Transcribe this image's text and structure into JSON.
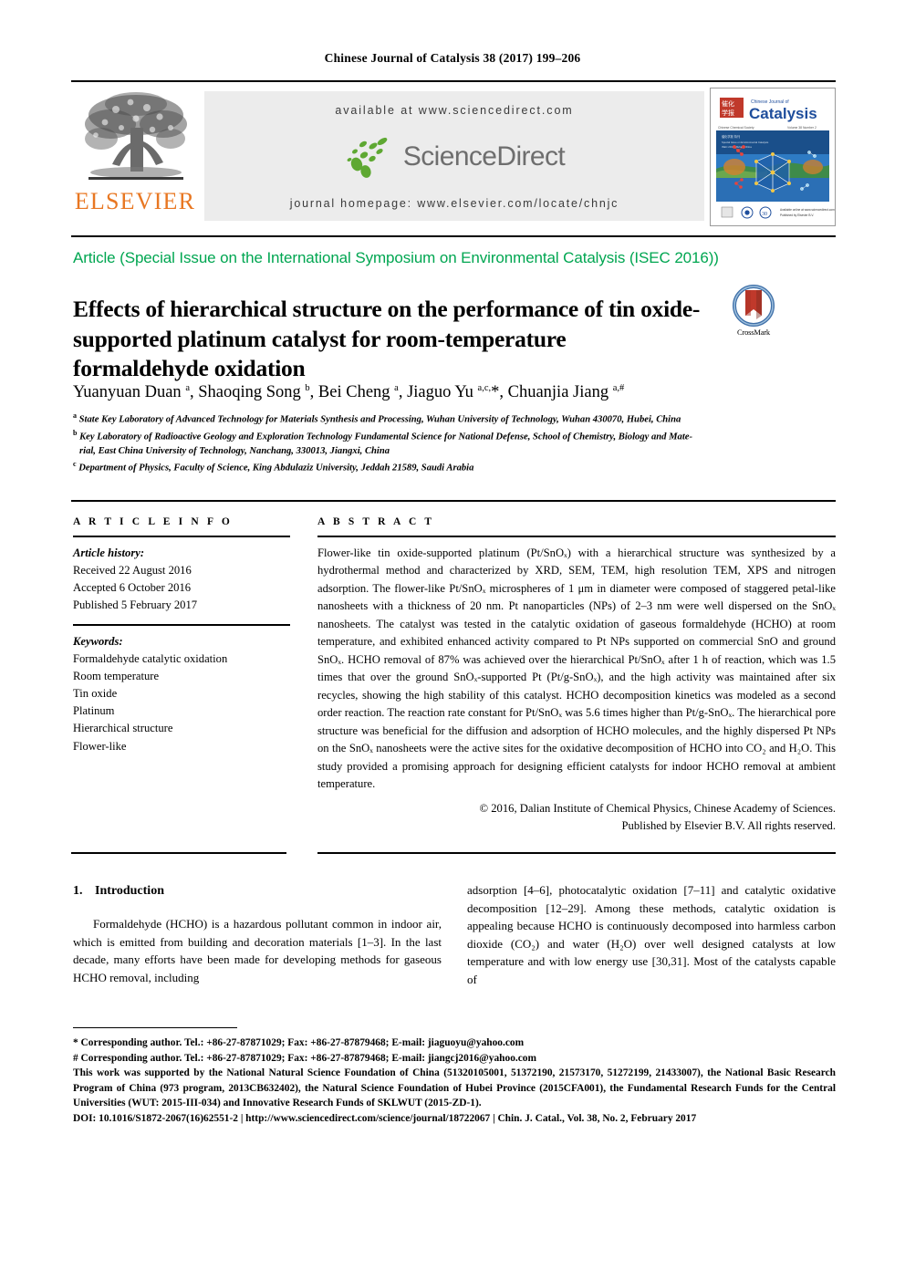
{
  "running_head": "Chinese Journal of Catalysis 38 (2017) 199–206",
  "masthead": {
    "publisher": "ELSEVIER",
    "available_at": "available at www.sciencedirect.com",
    "sciencedirect": "ScienceDirect",
    "journal_homepage": "journal homepage: www.elsevier.com/locate/chnjc",
    "cover": {
      "series_small": "Chinese Journal of",
      "title": "Catalysis",
      "chinese_title": "催化学报",
      "volume_line": "Volume 38  Number 2  February 2017"
    }
  },
  "article_type": "Article (Special Issue on the International Symposium on Environmental Catalysis (ISEC 2016))",
  "crossmark": {
    "label": "CrossMark"
  },
  "title": "Effects of hierarchical structure on the performance of tin oxide-supported platinum catalyst for room-temperature formaldehyde oxidation",
  "authors": "Yuanyuan Duan <sup>a</sup>, Shaoqing Song <sup>b</sup>, Bei Cheng <sup>a</sup>, Jiaguo Yu <sup>a,c,</sup>*, Chuanjia Jiang <sup>a,#</sup>",
  "affiliations": [
    {
      "marker": "a",
      "text": "State Key Laboratory of Advanced Technology for Materials Synthesis and Processing, Wuhan University of Technology, Wuhan 430070, Hubei, China"
    },
    {
      "marker": "b",
      "text": "Key Laboratory of Radioactive Geology and Exploration Technology Fundamental Science for National Defense, School of Chemistry, Biology and Mate-",
      "cont": "rial, East China University of Technology, Nanchang, 330013, Jiangxi, China"
    },
    {
      "marker": "c",
      "text": "Department of Physics, Faculty of Science, King Abdulaziz University, Jeddah 21589, Saudi Arabia"
    }
  ],
  "article_info": {
    "heading": "A R T I C L E    I N F O",
    "history_label": "Article history:",
    "history": [
      "Received 22 August 2016",
      "Accepted 6 October 2016",
      "Published 5 February 2017"
    ],
    "keywords_label": "Keywords:",
    "keywords": [
      "Formaldehyde catalytic oxidation",
      "Room temperature",
      "Tin oxide",
      "Platinum",
      "Hierarchical structure",
      "Flower-like"
    ]
  },
  "abstract": {
    "heading": "A B S T R A C T",
    "text": "Flower-like tin oxide-supported platinum (Pt/SnOₓ) with a hierarchical structure was synthesized by a hydrothermal method and characterized by XRD, SEM, TEM, high resolution TEM, XPS and nitrogen adsorption. The flower-like Pt/SnOₓ microspheres of 1 μm in diameter were composed of staggered petal-like nanosheets with a thickness of 20 nm. Pt nanoparticles (NPs) of 2–3 nm were well dispersed on the SnOₓ nanosheets. The catalyst was tested in the catalytic oxidation of gaseous formaldehyde (HCHO) at room temperature, and exhibited enhanced activity compared to Pt NPs supported on commercial SnO and ground SnOₓ. HCHO removal of 87% was achieved over the hierarchical Pt/SnOₓ after 1 h of reaction, which was 1.5 times that over the ground SnOₓ-supported Pt (Pt/g-SnOₓ), and the high activity was maintained after six recycles, showing the high stability of this catalyst. HCHO decomposition kinetics was modeled as a second order reaction. The reaction rate constant for Pt/SnOₓ was 5.6 times higher than Pt/g-SnOₓ. The hierarchical pore structure was beneficial for the diffusion and adsorption of HCHO molecules, and the highly dispersed Pt NPs on the SnOₓ nanosheets were the active sites for the oxidative decomposition of HCHO into CO₂ and H₂O. This study provided a promising approach for designing efficient catalysts for indoor HCHO removal at ambient temperature.",
    "copyright_line1": "© 2016, Dalian Institute of Chemical Physics, Chinese Academy of Sciences.",
    "copyright_line2": "Published by Elsevier B.V. All rights reserved."
  },
  "body": {
    "section_number": "1.",
    "section_title": "Introduction",
    "left_paragraph": "Formaldehyde (HCHO) is a hazardous pollutant common in indoor air, which is emitted from building and decoration materials [1–3]. In the last decade, many efforts have been made for developing methods for gaseous HCHO removal, including",
    "right_paragraph": "adsorption [4–6], photocatalytic oxidation [7–11] and catalytic oxidative decomposition [12–29]. Among these methods, catalytic oxidation is appealing because HCHO is continuously decomposed into harmless carbon dioxide (CO₂) and water (H₂O) over well designed catalysts at low temperature and with low energy use [30,31]. Most of the catalysts capable of"
  },
  "footnotes": {
    "corresponding1": "* Corresponding author. Tel.: +86-27-87871029; Fax: +86-27-87879468; E-mail: jiaguoyu@yahoo.com",
    "corresponding2": "# Corresponding author. Tel.: +86-27-87871029; Fax: +86-27-87879468; E-mail: jiangcj2016@yahoo.com",
    "funding": "This work was supported by the National Natural Science Foundation of China (51320105001, 51372190, 21573170, 51272199, 21433007), the National Basic Research Program of China (973 program, 2013CB632402), the Natural Science Foundation of Hubei Province (2015CFA001), the Fundamental Research Funds for the Central Universities (WUT: 2015-III-034) and Innovative Research Funds of SKLWUT (2015-ZD-1).",
    "doi": "DOI: 10.1016/S1872-2067(16)62551-2 | http://www.sciencedirect.com/science/journal/18722067 | Chin. J. Catal., Vol. 38, No. 2, February 2017"
  },
  "colors": {
    "article_type_green": "#00A651",
    "elsevier_orange": "#E87722",
    "sciencedirect_green": "#5EA832",
    "sciencedirect_gray": "#6E6E6E",
    "banner_bg": "#ECECEC"
  }
}
